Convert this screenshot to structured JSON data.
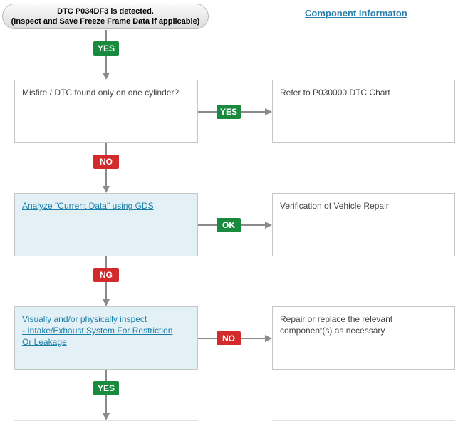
{
  "start": {
    "line1": "DTC P034DF3 is detected.",
    "line2": "(Inspect and Save Freeze Frame Data if applicable)"
  },
  "component_link": "Component Informaton",
  "steps": [
    {
      "left_text": "Misfire / DTC found only on one cylinder?",
      "right_text": "Refer to P030000 DTC Chart",
      "side_label": "YES",
      "down_label": "NO"
    },
    {
      "left_link": "Analyze \"Current Data\" using GDS",
      "right_text": "Verification of Vehicle Repair",
      "side_label": "OK",
      "down_label": "NG"
    },
    {
      "left_link_lines": [
        "Visually and/or physically inspect",
        "- Intake/Exhaust System For Restriction",
        "Or Leakage"
      ],
      "right_text_lines": [
        "Repair or replace the relevant",
        "component(s) as necessary"
      ],
      "side_label": "NO",
      "down_label": "YES"
    }
  ],
  "top_label": "YES",
  "colors": {
    "yes_green": "#1a8a3e",
    "no_red": "#d32b2b",
    "link_blue": "#1a7fa8",
    "box_blue": "#e3f1f6",
    "arrow_gray": "#8a8a8a"
  }
}
